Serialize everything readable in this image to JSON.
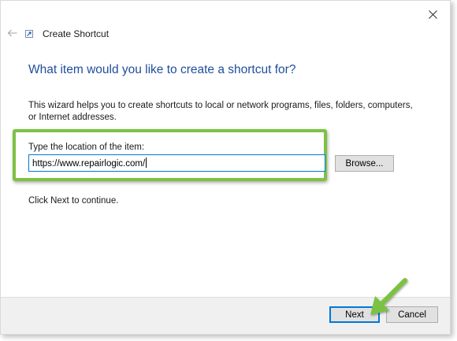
{
  "window": {
    "title": "Create Shortcut"
  },
  "icons": {
    "close": "close-icon",
    "back": "back-arrow-icon",
    "app": "shortcut-icon",
    "annotation": "green-arrow-icon"
  },
  "page": {
    "heading": "What item would you like to create a shortcut for?",
    "description": "This wizard helps you to create shortcuts to local or network programs, files, folders, computers, or Internet addresses.",
    "location_label": "Type the location of the item:",
    "location_value": "https://www.repairlogic.com/",
    "browse_label": "Browse...",
    "continue_text": "Click Next to continue."
  },
  "footer": {
    "next_label": "Next",
    "cancel_label": "Cancel"
  },
  "colors": {
    "heading": "#1f4e9b",
    "highlight": "#7cc243",
    "focus": "#0078d7"
  }
}
